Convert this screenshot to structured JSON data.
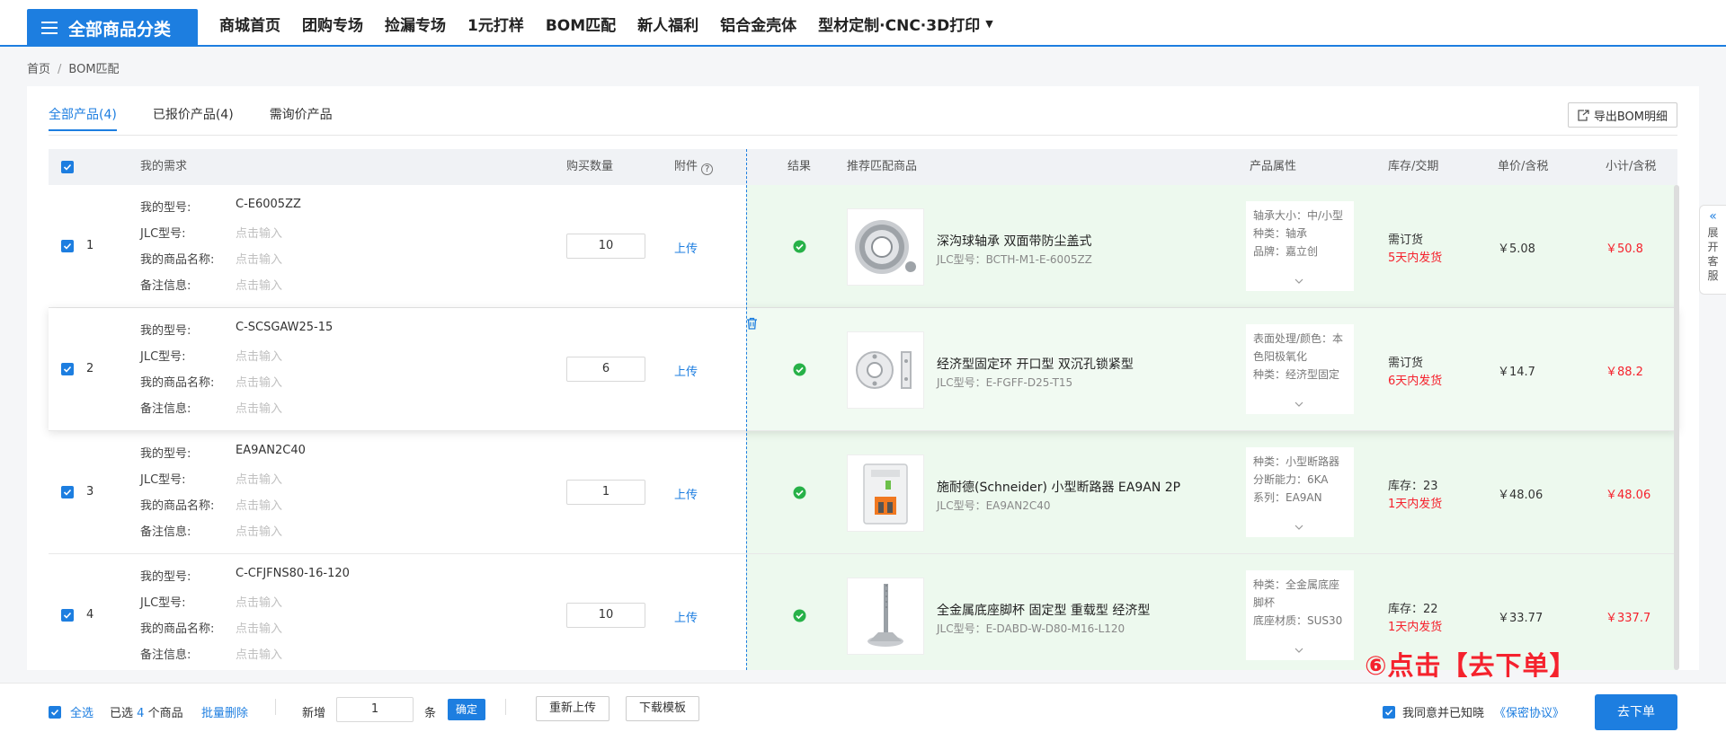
{
  "header": {
    "category_label": "全部商品分类",
    "nav": [
      "商城首页",
      "团购专场",
      "捡漏专场",
      "1元打样",
      "BOM匹配",
      "新人福利",
      "铝合金壳体",
      "型材定制·CNC·3D打印"
    ]
  },
  "breadcrumb": {
    "home": "首页",
    "sep": "/",
    "current": "BOM匹配"
  },
  "tabs": [
    "全部产品(4)",
    "已报价产品(4)",
    "需询价产品"
  ],
  "export_label": "导出BOM明细",
  "table_headers": {
    "demand": "我的需求",
    "qty": "购买数量",
    "attachment": "附件",
    "result": "结果",
    "recommend": "推荐匹配商品",
    "attrs": "产品属性",
    "stock": "库存/交期",
    "price": "单价/含税",
    "subtotal": "小计/含税"
  },
  "field_labels": {
    "model": "我的型号:",
    "jlc": "JLC型号:",
    "name": "我的商品名称:",
    "note": "备注信息:"
  },
  "placeholder": "点击输入",
  "upload_label": "上传",
  "rows": [
    {
      "index": "1",
      "model": "C-E6005ZZ",
      "qty": "10",
      "product_name": "深沟球轴承 双面带防尘盖式",
      "product_code": "JLC型号：BCTH-M1-E-6005ZZ",
      "attrs": [
        "轴承大小：中/小型",
        "种类：轴承",
        "品牌：嘉立创"
      ],
      "stock": "需订货",
      "delivery": "5天内发货",
      "price": "￥5.08",
      "subtotal": "￥50.8"
    },
    {
      "index": "2",
      "model": "C-SCSGAW25-15",
      "qty": "6",
      "product_name": "经济型固定环 开口型 双沉孔锁紧型",
      "product_code": "JLC型号：E-FGFF-D25-T15",
      "attrs": [
        "表面处理/颜色：本",
        "色阳极氧化",
        "种类：经济型固定"
      ],
      "stock": "需订货",
      "delivery": "6天内发货",
      "price": "￥14.7",
      "subtotal": "￥88.2"
    },
    {
      "index": "3",
      "model": "EA9AN2C40",
      "qty": "1",
      "product_name": "施耐德(Schneider) 小型断路器 EA9AN 2P",
      "product_code": "JLC型号：EA9AN2C40",
      "attrs": [
        "种类：小型断路器",
        "分断能力：6KA",
        "系列：EA9AN"
      ],
      "stock": "库存：23",
      "delivery": "1天内发货",
      "price": "￥48.06",
      "subtotal": "￥48.06"
    },
    {
      "index": "4",
      "model": "C-CFJFNS80-16-120",
      "qty": "10",
      "product_name": "全金属底座脚杯 固定型 重载型 经济型",
      "product_code": "JLC型号：E-DABD-W-D80-M16-L120",
      "attrs": [
        "种类：全金属底座",
        "脚杯",
        "底座材质：SUS30"
      ],
      "stock": "库存：22",
      "delivery": "1天内发货",
      "price": "￥33.77",
      "subtotal": "￥337.7"
    }
  ],
  "side_tab": {
    "arrow": "«",
    "label": "展开客服"
  },
  "footer": {
    "select_all": "全选",
    "selected_prefix": "已选",
    "selected_count": "4",
    "selected_suffix": "个商品",
    "batch_delete": "批量删除",
    "add_label": "新增",
    "add_value": "1",
    "unit": "条",
    "confirm": "确定",
    "reupload": "重新上传",
    "download_template": "下载模板",
    "agree_text": "我同意并已知晓",
    "agreement_link": "《保密协议》",
    "order_button": "去下单"
  },
  "annotation": "⑥点击【去下单】"
}
